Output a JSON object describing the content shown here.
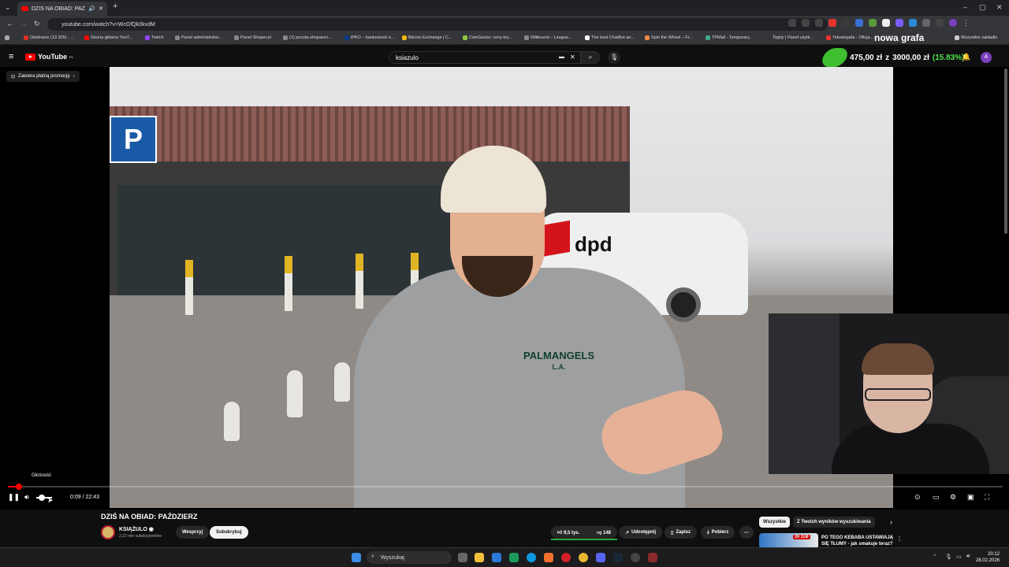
{
  "browser": {
    "tab_title": "DZIŚ NA OBIAD: PAŹDZIER",
    "new_tab_icon": "plus-icon",
    "url": "youtube.com/watch?v=WcGfQk0kvdM",
    "window_controls": [
      "–",
      "▢",
      "✕"
    ]
  },
  "bookmarks": [
    {
      "label": "Odebrane (13 325) - ..."
    },
    {
      "label": "Strona główna YouT..."
    },
    {
      "label": "Twitch"
    },
    {
      "label": "Panel administrator..."
    },
    {
      "label": "Panel Shoper.pl"
    },
    {
      "label": "(1) poczta-shoparen..."
    },
    {
      "label": "iPKO – bankowość e..."
    },
    {
      "label": "Bitcoin Exchange | C..."
    },
    {
      "label": "CoinGecko: ceny kry..."
    },
    {
      "label": "Riftbound – League..."
    },
    {
      "label": "The best ChatBot an..."
    },
    {
      "label": "Spin the Wheel – Fr..."
    },
    {
      "label": "TPMail - Temporary..."
    },
    {
      "label": "Tipply | Panel użytk..."
    },
    {
      "label": "Telewizjada - Oficja..."
    },
    {
      "label": "Wszystkie zakładki"
    }
  ],
  "youtube": {
    "logo_text": "YouTube",
    "logo_country": "PL",
    "search_value": "ksiazulo",
    "avatar_letter": "A"
  },
  "stream_overlay": {
    "amount": "475,00 zł",
    "separator": "z",
    "goal": "3000,00 zł",
    "percent": "(15.83%)",
    "caption": "nowa grafa"
  },
  "player": {
    "promo_label": "Zawiera płatną promocję",
    "progress_fraction": 0.007,
    "tooltip": "Głośność",
    "time_current": "0:09",
    "time_total": "22:43",
    "scene_text_dpd": "dpd",
    "scene_text_brand": "PALMANGELS",
    "scene_text_brand2": "L.A.",
    "scene_text_sign": "P"
  },
  "video": {
    "title": "DZIŚ NA OBIAD: PAŹDZIERZ",
    "channel": "KSIĄŻULO",
    "subscribers": "2,22 mln subskrybentów",
    "support_label": "Wesprzyj",
    "subscribe_label": "Subskrybuj",
    "likes": "9,5 tys.",
    "dislikes": "148",
    "share_label": "Udostępnij",
    "save_label": "Zapisz",
    "download_label": "Pobierz"
  },
  "sidebar": {
    "chips": [
      "Wszystkie",
      "Z Twoich wyników wyszukiwania"
    ],
    "rec_badge": "2H 31M",
    "rec_title": "PO TEGO KEBABA USTAWIAJĄ SIĘ TŁUMY - jak smakuje teraz?"
  },
  "taskbar": {
    "search_placeholder": "Wyszukaj",
    "time": "20:12",
    "date": "28.02.2026"
  }
}
